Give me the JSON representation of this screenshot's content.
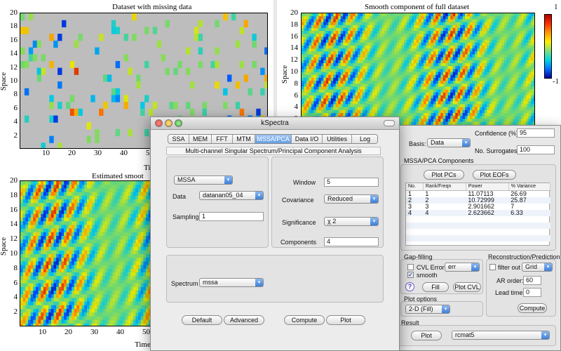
{
  "plots": {
    "p1": {
      "title": "Dataset with missing data",
      "ylabel": "Space",
      "yticks": [
        "20",
        "18",
        "16",
        "14",
        "12",
        "10",
        "8",
        "6",
        "4",
        "2"
      ],
      "xticks": [
        "10",
        "20",
        "30",
        "40",
        "5"
      ],
      "xlabel_partial": "Ti"
    },
    "p2": {
      "title": "Smooth component of full dataset",
      "ylabel": "Space",
      "yticks": [
        "20",
        "18",
        "16",
        "14",
        "12",
        "10",
        "8",
        "6",
        "4",
        "2"
      ],
      "colorbar": {
        "max": "1",
        "min": "-1"
      }
    },
    "p3": {
      "title": "Estimated smoot",
      "ylabel": "Space",
      "yticks": [
        "20",
        "18",
        "16",
        "14",
        "12",
        "10",
        "8",
        "6",
        "4",
        "2"
      ],
      "xticks": [
        "10",
        "20",
        "30",
        "40",
        "50"
      ],
      "xlabel_partial": "Time"
    }
  },
  "kspectra": {
    "title": "kSpectra",
    "tabs": [
      "SSA",
      "MEM",
      "FFT",
      "MTM",
      "MSSA/PCA",
      "Data I/O",
      "Utilities",
      "Log"
    ],
    "active_tab": "MSSA/PCA",
    "section_title": "Multi-channel Singular Spectrum/Principal Component Analysis",
    "method": "MSSA",
    "data_label": "Data",
    "data_value": "datanan05_04",
    "sampling_label": "Sampling",
    "sampling_value": "1",
    "window_label": "Window",
    "window_value": "5",
    "covariance_label": "Covariance",
    "covariance_value": "Reduced",
    "significance_label": "Significance",
    "significance_value": "χ 2",
    "components_label": "Components",
    "components_value": "4",
    "spectrum_label": "Spectrum",
    "spectrum_value": "mssa",
    "buttons": {
      "default": "Default",
      "advanced": "Advanced",
      "compute": "Compute",
      "plot": "Plot"
    }
  },
  "panel": {
    "confidence_label": "Confidence (%):",
    "confidence_value": "95",
    "basis_label": "Basis:",
    "basis_value": "Data",
    "surrogates_label": "No. Surrogates:",
    "surrogates_value": "100",
    "components_title": "MSSA/PCA Components",
    "plot_pcs": "Plot PCs",
    "plot_eofs": "Plot EOFs",
    "table": {
      "headers": [
        "No.",
        "Rank/Freqn",
        "Power",
        "% Variance"
      ],
      "rows": [
        [
          "1",
          "1",
          "11.07113",
          "26.69"
        ],
        [
          "2",
          "2",
          "10.72999",
          "25.87"
        ],
        [
          "3",
          "3",
          "2.901662",
          "7"
        ],
        [
          "4",
          "4",
          "2.623662",
          "6.33"
        ]
      ]
    },
    "gap_title": "Gap-filling",
    "cvl_error": "CVL Error",
    "err_value": "err",
    "smooth": "smooth",
    "fill": "Fill",
    "plot_cvl": "Plot CVL",
    "recon_title": "Reconstruction/Prediction",
    "filter_out": "filter out",
    "grid_value": "Grid",
    "ar_order_label": "AR order:",
    "ar_order_value": "60",
    "lead_time_label": "Lead time:",
    "lead_time_value": "0",
    "recon_compute": "Compute",
    "plot_options_title": "Plot options",
    "plot_options_value": "2-D (Fill)",
    "result_title": "Result",
    "result_plot": "Plot",
    "result_value": "rcmat5"
  }
}
